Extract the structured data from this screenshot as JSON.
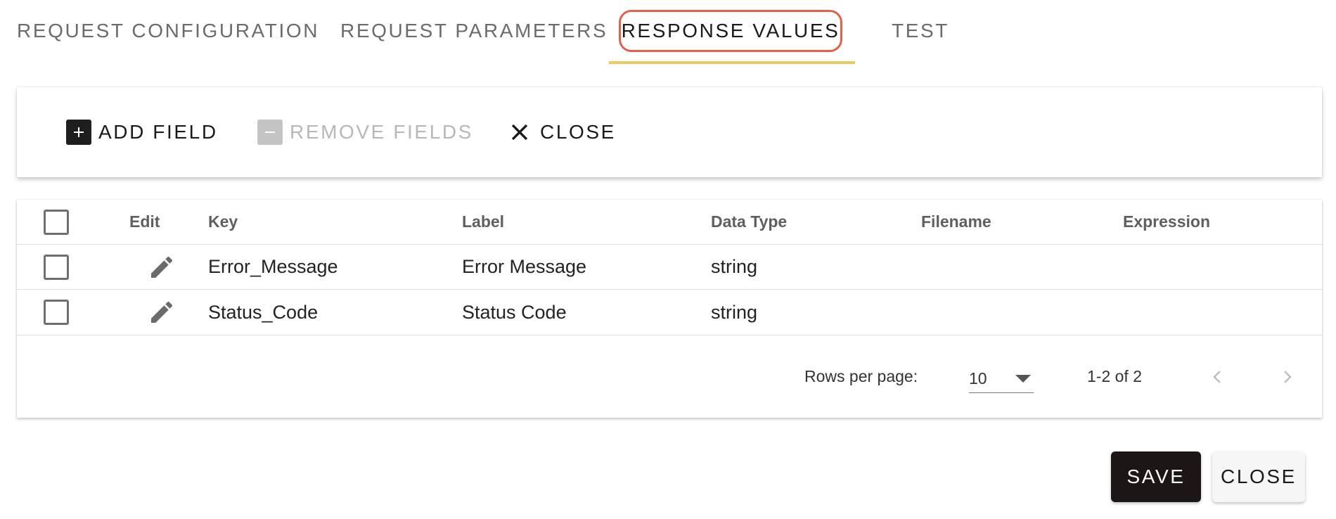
{
  "tabs": [
    {
      "label": "REQUEST CONFIGURATION",
      "active": false
    },
    {
      "label": "REQUEST PARAMETERS",
      "active": false
    },
    {
      "label": "RESPONSE VALUES",
      "active": true
    },
    {
      "label": "TEST",
      "active": false
    }
  ],
  "toolbar": {
    "add_label": "ADD FIELD",
    "add_icon": "plus-box-icon",
    "remove_label": "REMOVE FIELDS",
    "remove_icon": "minus-box-icon",
    "close_label": "CLOSE",
    "close_icon": "close-icon"
  },
  "table": {
    "headers": {
      "edit": "Edit",
      "key": "Key",
      "label": "Label",
      "data_type": "Data Type",
      "filename": "Filename",
      "expression": "Expression"
    },
    "rows": [
      {
        "key": "Error_Message",
        "label": "Error Message",
        "data_type": "string",
        "filename": "",
        "expression": ""
      },
      {
        "key": "Status_Code",
        "label": "Status Code",
        "data_type": "string",
        "filename": "",
        "expression": ""
      }
    ]
  },
  "pagination": {
    "rows_per_page_label": "Rows per page:",
    "rows_per_page_value": "10",
    "range_text": "1-2 of 2"
  },
  "footer": {
    "save_label": "SAVE",
    "close_label": "CLOSE"
  },
  "colors": {
    "active_tab_outline": "#e0614a",
    "tab_indicator": "#f2c85b",
    "save_button_bg": "#1c1716"
  }
}
